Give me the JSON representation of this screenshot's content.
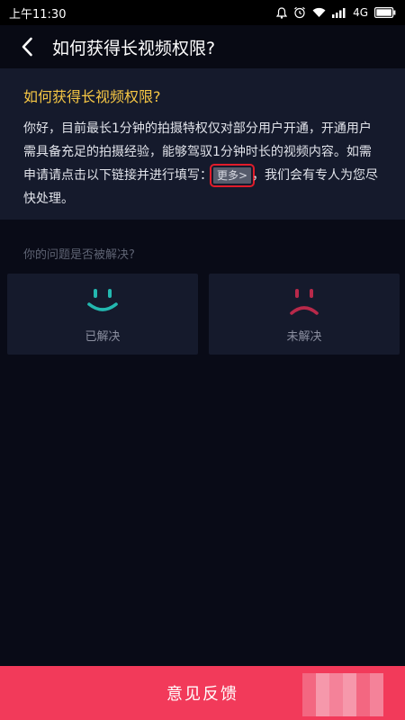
{
  "status_bar": {
    "time": "上午11:30",
    "network": "4G",
    "icons": [
      "bell-icon",
      "alarm-icon",
      "wifi-icon",
      "signal-icon",
      "battery-icon"
    ]
  },
  "nav": {
    "title": "如何获得长视频权限?",
    "back_icon": "chevron-left-icon"
  },
  "article": {
    "title": "如何获得长视频权限?",
    "body_before": "你好，目前最长1分钟的拍摄特权仅对部分用户开通，开通用户需具备充足的拍摄经验，能够驾驭1分钟时长的视频内容。如需申请请点击以下链接并进行填写：",
    "more_link": "更多>",
    "body_after": "，我们会有专人为您尽快处理。"
  },
  "feedback_question": {
    "text": "你的问题是否被解决?",
    "options": [
      {
        "label": "已解决",
        "icon": "smile-icon",
        "color": "#23b8b0"
      },
      {
        "label": "未解决",
        "icon": "frown-icon",
        "color": "#b8294a"
      }
    ]
  },
  "bottom_button": {
    "label": "意见反馈",
    "color": "#f23a5a"
  }
}
